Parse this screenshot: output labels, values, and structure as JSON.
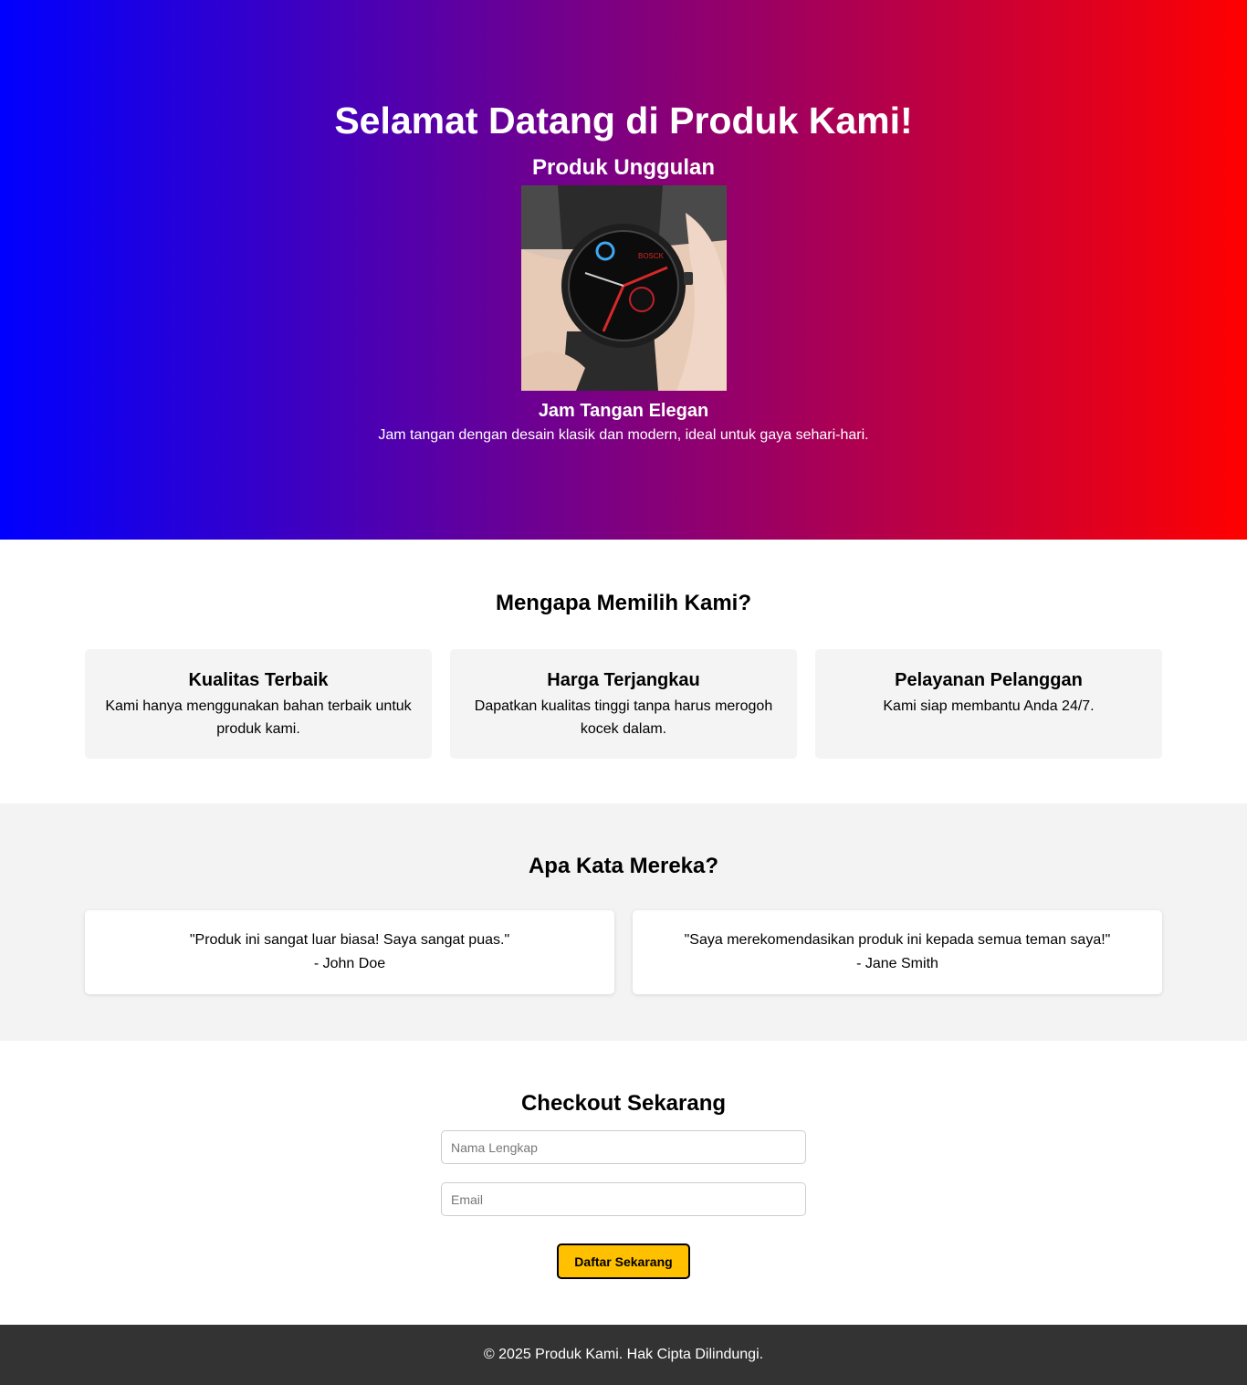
{
  "hero": {
    "title": "Selamat Datang di Produk Kami!",
    "subtitle": "Produk Unggulan",
    "product_name": "Jam Tangan Elegan",
    "product_desc": "Jam tangan dengan desain klasik dan modern, ideal untuk gaya sehari-hari.",
    "gradient_start": "#0000ff",
    "gradient_end": "#ff0000"
  },
  "why": {
    "title": "Mengapa Memilih Kami?",
    "cards": [
      {
        "title": "Kualitas Terbaik",
        "text": "Kami hanya menggunakan bahan terbaik untuk produk kami."
      },
      {
        "title": "Harga Terjangkau",
        "text": "Dapatkan kualitas tinggi tanpa harus merogoh kocek dalam."
      },
      {
        "title": "Pelayanan Pelanggan",
        "text": "Kami siap membantu Anda 24/7."
      }
    ]
  },
  "testimonials": {
    "title": "Apa Kata Mereka?",
    "items": [
      {
        "quote": "\"Produk ini sangat luar biasa! Saya sangat puas.\"",
        "author": "- John Doe"
      },
      {
        "quote": "\"Saya merekomendasikan produk ini kepada semua teman saya!\"",
        "author": "- Jane Smith"
      }
    ]
  },
  "checkout": {
    "title": "Checkout Sekarang",
    "name_placeholder": "Nama Lengkap",
    "email_placeholder": "Email",
    "button_label": "Daftar Sekarang",
    "button_color": "#ffc000"
  },
  "footer": {
    "text": "© 2025 Produk Kami. Hak Cipta Dilindungi."
  }
}
